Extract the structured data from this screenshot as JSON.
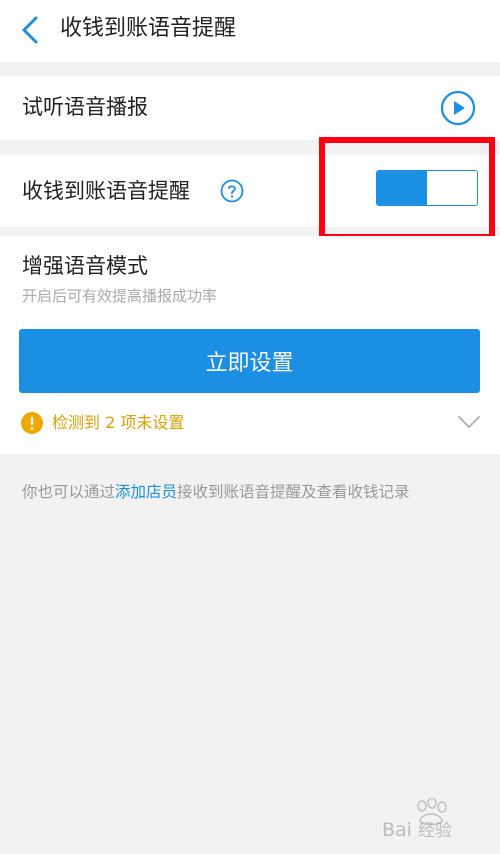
{
  "header": {
    "title": "收钱到账语音提醒",
    "back_icon": "chevron-left-icon"
  },
  "preview": {
    "label": "试听语音播报",
    "icon": "play-icon"
  },
  "voice_alert": {
    "label": "收钱到账语音提醒",
    "help_icon": "question-icon",
    "enabled": true
  },
  "enhance": {
    "title": "增强语音模式",
    "subtitle": "开启后可有效提高播报成功率",
    "button_label": "立即设置",
    "warning_icon": "info-icon",
    "warning_text": "检测到 2 项未设置"
  },
  "footer": {
    "prefix": "你也可以通过",
    "link": "添加店员",
    "suffix": "接收到账语音提醒及查看收钱记录"
  },
  "colors": {
    "accent": "#1a8fe3",
    "warning": "#e0a000",
    "highlight": "#ff0010"
  },
  "watermark": {
    "text": "Bai经验"
  }
}
